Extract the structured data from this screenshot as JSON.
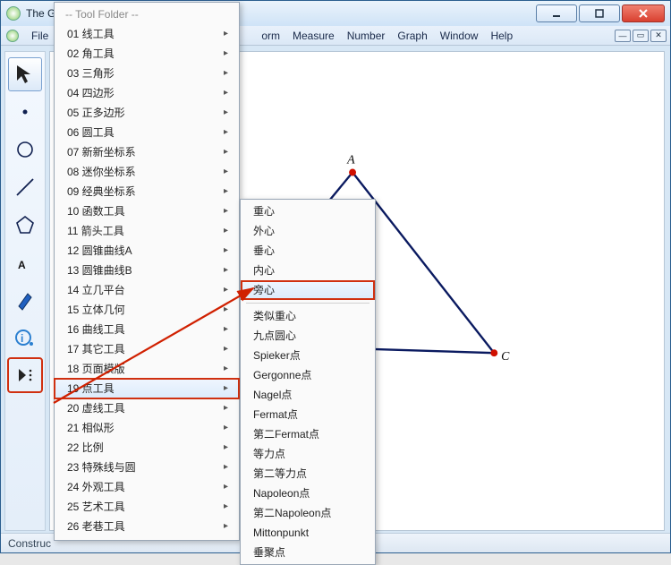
{
  "window": {
    "outer_title": "The G",
    "menubar_first": "File",
    "menubar_rest": [
      "orm",
      "Measure",
      "Number",
      "Graph",
      "Window",
      "Help"
    ]
  },
  "toolbar_icons": [
    "arrow",
    "point",
    "circle",
    "segment",
    "polygon",
    "text",
    "marker",
    "info",
    "custom"
  ],
  "triangle": {
    "labels": {
      "A": "A",
      "C": "C"
    }
  },
  "statusbar": {
    "text": "Construc"
  },
  "menu1": {
    "header": "-- Tool Folder --",
    "items": [
      {
        "label": "01 线工具",
        "sub": true
      },
      {
        "label": "02 角工具",
        "sub": true
      },
      {
        "label": "03 三角形",
        "sub": true
      },
      {
        "label": "04 四边形",
        "sub": true
      },
      {
        "label": "05 正多边形",
        "sub": true
      },
      {
        "label": "06 圆工具",
        "sub": true
      },
      {
        "label": "07 新新坐标系",
        "sub": true
      },
      {
        "label": "08 迷你坐标系",
        "sub": true
      },
      {
        "label": "09 经典坐标系",
        "sub": true
      },
      {
        "label": "10 函数工具",
        "sub": true
      },
      {
        "label": "11 箭头工具",
        "sub": true
      },
      {
        "label": "12 圆锥曲线A",
        "sub": true
      },
      {
        "label": "13 圆锥曲线B",
        "sub": true
      },
      {
        "label": "14 立几平台",
        "sub": true
      },
      {
        "label": "15 立体几何",
        "sub": true
      },
      {
        "label": "16 曲线工具",
        "sub": true
      },
      {
        "label": "17 其它工具",
        "sub": true
      },
      {
        "label": "18 页面模版",
        "sub": true
      },
      {
        "label": "19 点工具",
        "sub": true,
        "red": true,
        "hover": true
      },
      {
        "label": "20 虚线工具",
        "sub": true
      },
      {
        "label": "21 相似形",
        "sub": true
      },
      {
        "label": "22 比例",
        "sub": true
      },
      {
        "label": "23 特殊线与圆",
        "sub": true
      },
      {
        "label": "24 外观工具",
        "sub": true
      },
      {
        "label": "25 艺术工具",
        "sub": true
      },
      {
        "label": "26 老巷工具",
        "sub": true
      }
    ]
  },
  "menu2": {
    "items": [
      {
        "label": "重心"
      },
      {
        "label": "外心"
      },
      {
        "label": "垂心"
      },
      {
        "label": "内心"
      },
      {
        "label": "旁心",
        "red": true,
        "hover": true
      },
      {
        "sep": true
      },
      {
        "label": "类似重心"
      },
      {
        "label": "九点圆心"
      },
      {
        "label": "Spieker点"
      },
      {
        "label": "Gergonne点"
      },
      {
        "label": "Nagel点"
      },
      {
        "label": "Fermat点"
      },
      {
        "label": "第二Fermat点"
      },
      {
        "label": "等力点"
      },
      {
        "label": "第二等力点"
      },
      {
        "label": "Napoleon点"
      },
      {
        "label": "第二Napoleon点"
      },
      {
        "label": "Mittonpunkt"
      },
      {
        "label": "垂聚点"
      }
    ]
  }
}
